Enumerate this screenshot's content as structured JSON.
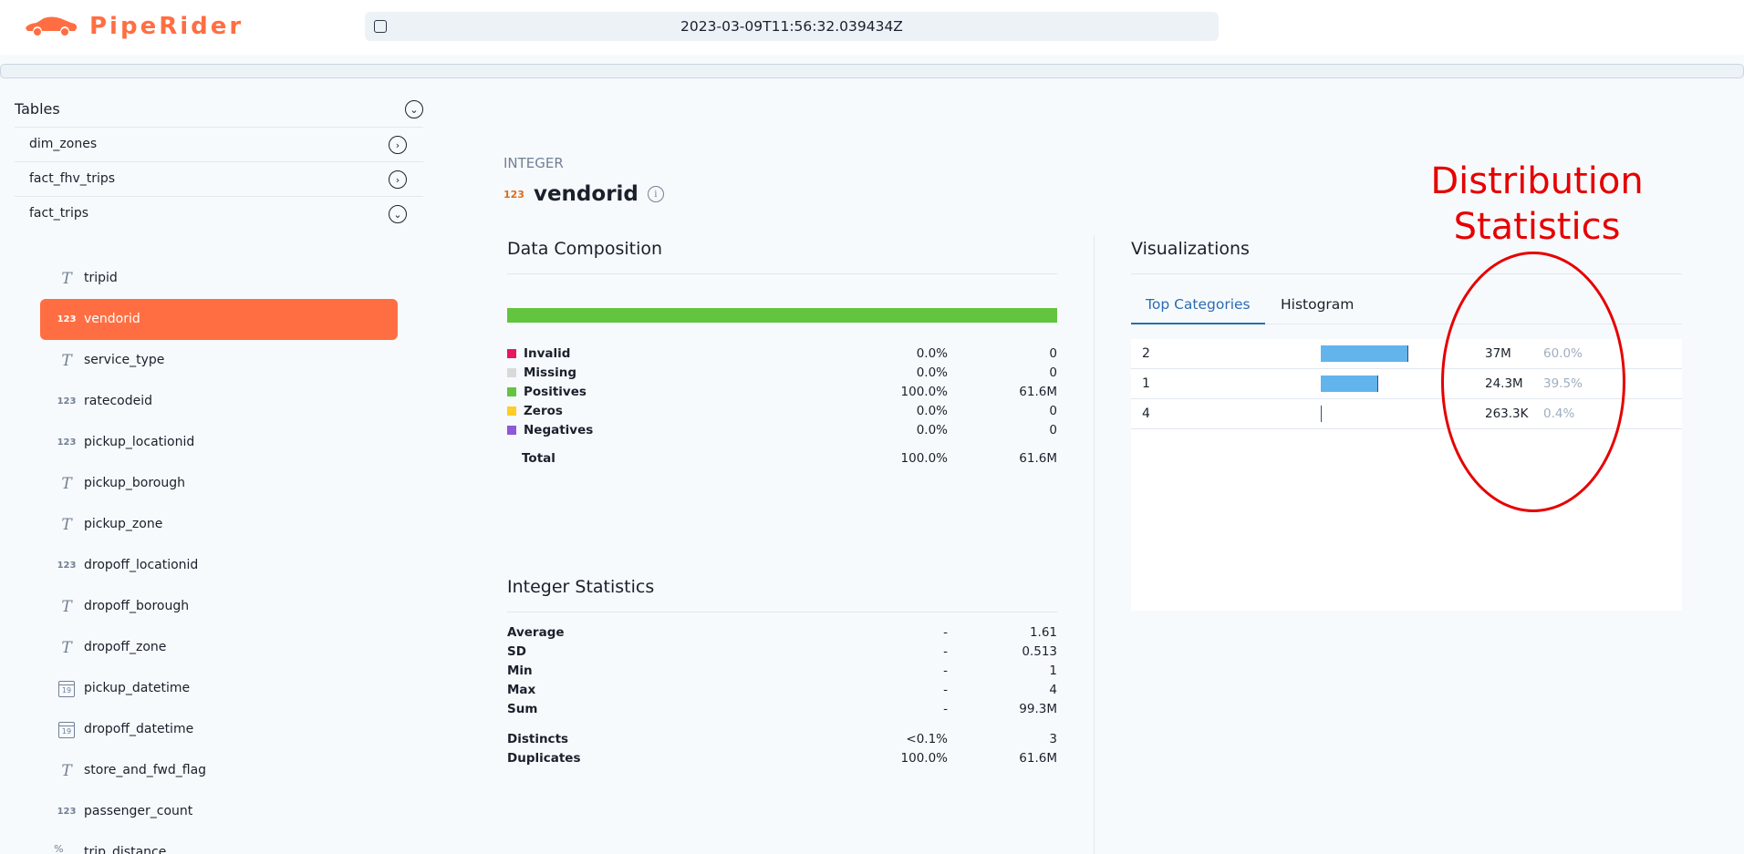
{
  "app": {
    "brand": "PipeRider",
    "run_timestamp": "2023-03-09T11:56:32.039434Z"
  },
  "sidebar": {
    "title": "Tables",
    "tables": [
      {
        "label": "dim_zones",
        "expanded": false
      },
      {
        "label": "fact_fhv_trips",
        "expanded": false
      },
      {
        "label": "fact_trips",
        "expanded": true
      }
    ],
    "columns": [
      {
        "label": "tripid",
        "icon": "text-type-icon"
      },
      {
        "label": "vendorid",
        "icon": "integer-type-icon",
        "active": true
      },
      {
        "label": "service_type",
        "icon": "text-type-icon"
      },
      {
        "label": "ratecodeid",
        "icon": "integer-type-icon"
      },
      {
        "label": "pickup_locationid",
        "icon": "integer-type-icon"
      },
      {
        "label": "pickup_borough",
        "icon": "text-type-icon"
      },
      {
        "label": "pickup_zone",
        "icon": "text-type-icon"
      },
      {
        "label": "dropoff_locationid",
        "icon": "integer-type-icon"
      },
      {
        "label": "dropoff_borough",
        "icon": "text-type-icon"
      },
      {
        "label": "dropoff_zone",
        "icon": "text-type-icon"
      },
      {
        "label": "pickup_datetime",
        "icon": "datetime-type-icon"
      },
      {
        "label": "dropoff_datetime",
        "icon": "datetime-type-icon"
      },
      {
        "label": "store_and_fwd_flag",
        "icon": "text-type-icon"
      },
      {
        "label": "passenger_count",
        "icon": "integer-type-icon"
      },
      {
        "label": "trip_distance",
        "icon": "numeric-type-icon"
      }
    ],
    "icon_glyphs": {
      "text": "T",
      "integer": "123",
      "datetime": "19",
      "numeric": "%−×+"
    }
  },
  "column": {
    "type": "INTEGER",
    "type_icon": "123",
    "name": "vendorid",
    "info_icon": "i"
  },
  "composition": {
    "title": "Data Composition",
    "bar_fill_fraction": 1.0,
    "rows": [
      {
        "label": "Invalid",
        "pct": "0.0%",
        "count": "0",
        "color": "#e8175d"
      },
      {
        "label": "Missing",
        "pct": "0.0%",
        "count": "0",
        "color": "#d9d9d9"
      },
      {
        "label": "Positives",
        "pct": "100.0%",
        "count": "61.6M",
        "color": "#63c440"
      },
      {
        "label": "Zeros",
        "pct": "0.0%",
        "count": "0",
        "color": "#ffcc29"
      },
      {
        "label": "Negatives",
        "pct": "0.0%",
        "count": "0",
        "color": "#8e58d8"
      }
    ],
    "total": {
      "label": "Total",
      "pct": "100.0%",
      "count": "61.6M"
    }
  },
  "integer_stats": {
    "title": "Integer Statistics",
    "rows": [
      {
        "label": "Average",
        "pct": "-",
        "value": "1.61"
      },
      {
        "label": "SD",
        "pct": "-",
        "value": "0.513"
      },
      {
        "label": "Min",
        "pct": "-",
        "value": "1"
      },
      {
        "label": "Max",
        "pct": "-",
        "value": "4"
      },
      {
        "label": "Sum",
        "pct": "-",
        "value": "99.3M"
      }
    ],
    "rows2": [
      {
        "label": "Distincts",
        "pct": "<0.1%",
        "value": "3"
      },
      {
        "label": "Duplicates",
        "pct": "100.0%",
        "value": "61.6M"
      }
    ]
  },
  "visualizations": {
    "title": "Visualizations",
    "tabs": [
      {
        "label": "Top Categories",
        "active": true
      },
      {
        "label": "Histogram",
        "active": false
      }
    ],
    "categories": [
      {
        "name": "2",
        "count": "37M",
        "pct": "60.0%",
        "fraction": 0.6
      },
      {
        "name": "1",
        "count": "24.3M",
        "pct": "39.5%",
        "fraction": 0.395
      },
      {
        "name": "4",
        "count": "263.3K",
        "pct": "0.4%",
        "fraction": 0.004
      }
    ]
  },
  "annotation": {
    "line1": "Distribution",
    "line2": "Statistics",
    "color": "#e60000"
  }
}
